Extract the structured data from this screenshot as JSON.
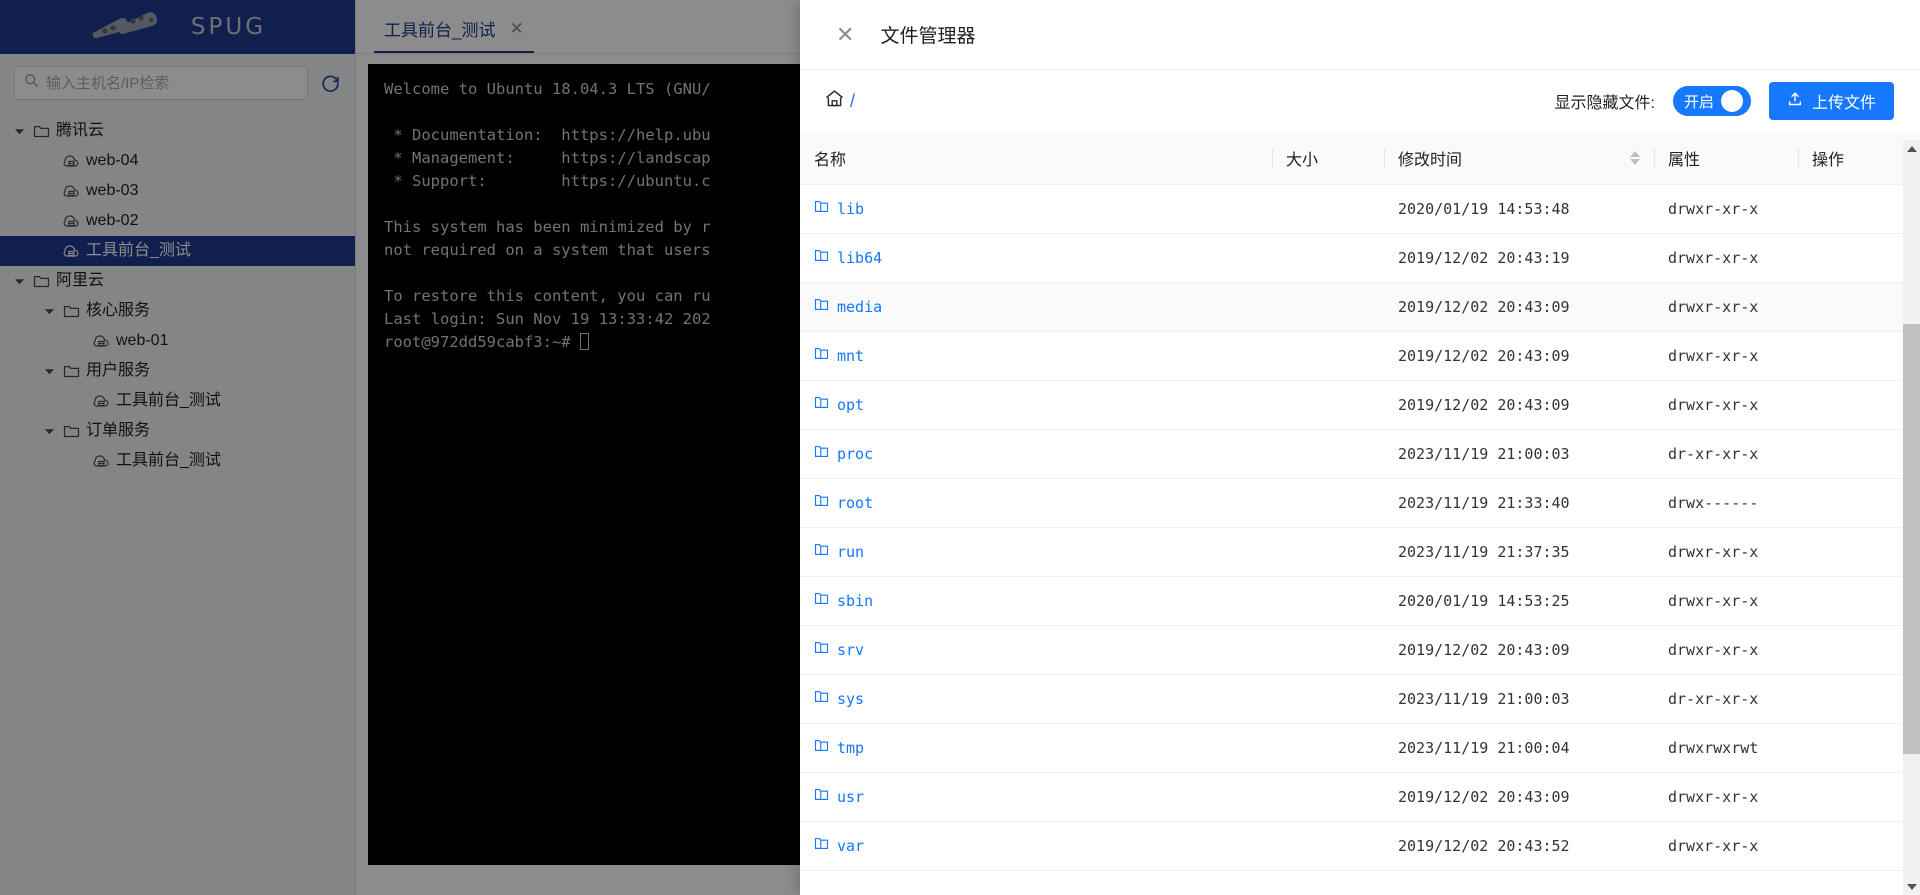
{
  "brand": {
    "name": "SPUG"
  },
  "sidebar": {
    "search": {
      "placeholder": "输入主机名/IP检索",
      "value": ""
    },
    "refresh_title": "刷新",
    "tree": [
      {
        "label": "腾讯云",
        "type": "folder",
        "depth": 0,
        "expanded": true,
        "selected": false
      },
      {
        "label": "web-04",
        "type": "host",
        "depth": 1,
        "expanded": null,
        "selected": false
      },
      {
        "label": "web-03",
        "type": "host",
        "depth": 1,
        "expanded": null,
        "selected": false
      },
      {
        "label": "web-02",
        "type": "host",
        "depth": 1,
        "expanded": null,
        "selected": false
      },
      {
        "label": "工具前台_测试",
        "type": "host",
        "depth": 1,
        "expanded": null,
        "selected": true
      },
      {
        "label": "阿里云",
        "type": "folder",
        "depth": 0,
        "expanded": true,
        "selected": false
      },
      {
        "label": "核心服务",
        "type": "folder",
        "depth": 1,
        "expanded": true,
        "selected": false
      },
      {
        "label": "web-01",
        "type": "host",
        "depth": 2,
        "expanded": null,
        "selected": false
      },
      {
        "label": "用户服务",
        "type": "folder",
        "depth": 1,
        "expanded": true,
        "selected": false
      },
      {
        "label": "工具前台_测试",
        "type": "host",
        "depth": 2,
        "expanded": null,
        "selected": false
      },
      {
        "label": "订单服务",
        "type": "folder",
        "depth": 1,
        "expanded": true,
        "selected": false
      },
      {
        "label": "工具前台_测试",
        "type": "host",
        "depth": 2,
        "expanded": null,
        "selected": false
      }
    ]
  },
  "tabs": [
    {
      "label": "工具前台_测试",
      "close": "✕",
      "active": true
    }
  ],
  "terminal": {
    "lines": [
      "Welcome to Ubuntu 18.04.3 LTS (GNU/",
      "",
      " * Documentation:  https://help.ubu",
      " * Management:     https://landscap",
      " * Support:        https://ubuntu.c",
      "",
      "This system has been minimized by r",
      "not required on a system that users",
      "",
      "To restore this content, you can ru",
      "Last login: Sun Nov 19 13:33:42 202"
    ],
    "prompt": "root@972dd59cabf3:~# "
  },
  "modal": {
    "title": "文件管理器",
    "close_icon": "✕",
    "breadcrumb": {
      "home_icon": "home-icon",
      "path": "/"
    },
    "hidden_files": {
      "label": "显示隐藏文件:",
      "state": "开启",
      "enabled": true
    },
    "upload": {
      "label": "上传文件",
      "icon": "upload-icon"
    },
    "columns": [
      {
        "key": "name",
        "label": "名称"
      },
      {
        "key": "size",
        "label": "大小"
      },
      {
        "key": "mtime",
        "label": "修改时间",
        "sortable": true
      },
      {
        "key": "attr",
        "label": "属性"
      },
      {
        "key": "ops",
        "label": "操作"
      }
    ],
    "rows": [
      {
        "name": "lib",
        "size": "",
        "mtime": "2020/01/19 14:53:48",
        "attr": "drwxr-xr-x",
        "ops": "",
        "hovered": false
      },
      {
        "name": "lib64",
        "size": "",
        "mtime": "2019/12/02 20:43:19",
        "attr": "drwxr-xr-x",
        "ops": "",
        "hovered": false
      },
      {
        "name": "media",
        "size": "",
        "mtime": "2019/12/02 20:43:09",
        "attr": "drwxr-xr-x",
        "ops": "",
        "hovered": true
      },
      {
        "name": "mnt",
        "size": "",
        "mtime": "2019/12/02 20:43:09",
        "attr": "drwxr-xr-x",
        "ops": "",
        "hovered": false
      },
      {
        "name": "opt",
        "size": "",
        "mtime": "2019/12/02 20:43:09",
        "attr": "drwxr-xr-x",
        "ops": "",
        "hovered": false
      },
      {
        "name": "proc",
        "size": "",
        "mtime": "2023/11/19 21:00:03",
        "attr": "dr-xr-xr-x",
        "ops": "",
        "hovered": false
      },
      {
        "name": "root",
        "size": "",
        "mtime": "2023/11/19 21:33:40",
        "attr": "drwx------",
        "ops": "",
        "hovered": false
      },
      {
        "name": "run",
        "size": "",
        "mtime": "2023/11/19 21:37:35",
        "attr": "drwxr-xr-x",
        "ops": "",
        "hovered": false
      },
      {
        "name": "sbin",
        "size": "",
        "mtime": "2020/01/19 14:53:25",
        "attr": "drwxr-xr-x",
        "ops": "",
        "hovered": false
      },
      {
        "name": "srv",
        "size": "",
        "mtime": "2019/12/02 20:43:09",
        "attr": "drwxr-xr-x",
        "ops": "",
        "hovered": false
      },
      {
        "name": "sys",
        "size": "",
        "mtime": "2023/11/19 21:00:03",
        "attr": "dr-xr-xr-x",
        "ops": "",
        "hovered": false
      },
      {
        "name": "tmp",
        "size": "",
        "mtime": "2023/11/19 21:00:04",
        "attr": "drwxrwxrwt",
        "ops": "",
        "hovered": false
      },
      {
        "name": "usr",
        "size": "",
        "mtime": "2019/12/02 20:43:09",
        "attr": "drwxr-xr-x",
        "ops": "",
        "hovered": false
      },
      {
        "name": "var",
        "size": "",
        "mtime": "2019/12/02 20:43:52",
        "attr": "drwxr-xr-x",
        "ops": "",
        "hovered": false
      }
    ]
  },
  "colors": {
    "brand_blue": "#1e3a8f",
    "accent_blue": "#1677ff",
    "sidebar_bg": "#f0f2f5",
    "terminal_bg": "#000000"
  }
}
